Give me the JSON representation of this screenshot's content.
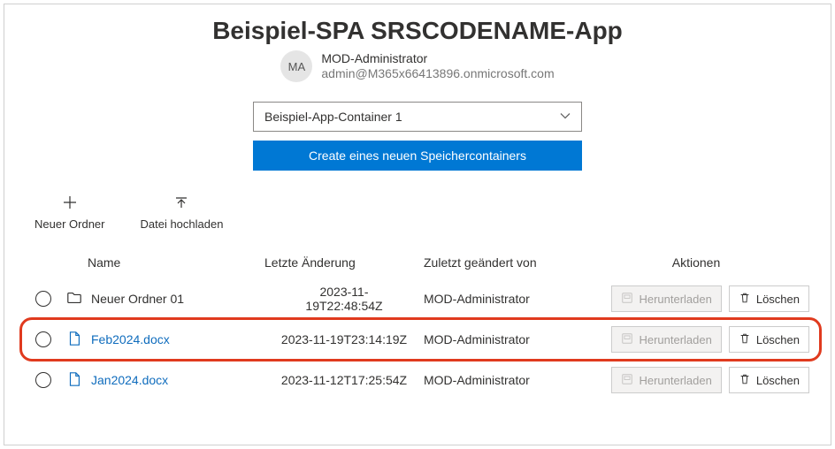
{
  "header": {
    "title": "Beispiel-SPA SRSCODENAME-App",
    "avatar_initials": "MA",
    "user_name": "MOD-Administrator",
    "user_email": "admin@M365x66413896.onmicrosoft.com"
  },
  "container": {
    "selected": "Beispiel-App-Container 1",
    "create_button": "Create eines neuen Speichercontainers"
  },
  "commands": {
    "new_folder": "Neuer Ordner",
    "upload": "Datei hochladen"
  },
  "columns": {
    "name": "Name",
    "modified": "Letzte Änderung",
    "modified_by": "Zuletzt geändert von",
    "actions": "Aktionen"
  },
  "action_labels": {
    "download": "Herunterladen",
    "delete": "Löschen"
  },
  "rows": [
    {
      "kind": "folder",
      "name": "Neuer Ordner 01",
      "modified": "2023-11-19T22:48:54Z",
      "modified_wrap": true,
      "modified_by": "MOD-Administrator",
      "download_disabled": true,
      "highlighted": false
    },
    {
      "kind": "file",
      "name": "Feb2024.docx",
      "modified": "2023-11-19T23:14:19Z",
      "modified_wrap": false,
      "modified_by": "MOD-Administrator",
      "download_disabled": true,
      "highlighted": true
    },
    {
      "kind": "file",
      "name": "Jan2024.docx",
      "modified": "2023-11-12T17:25:54Z",
      "modified_wrap": false,
      "modified_by": "MOD-Administrator",
      "download_disabled": true,
      "highlighted": false
    }
  ]
}
